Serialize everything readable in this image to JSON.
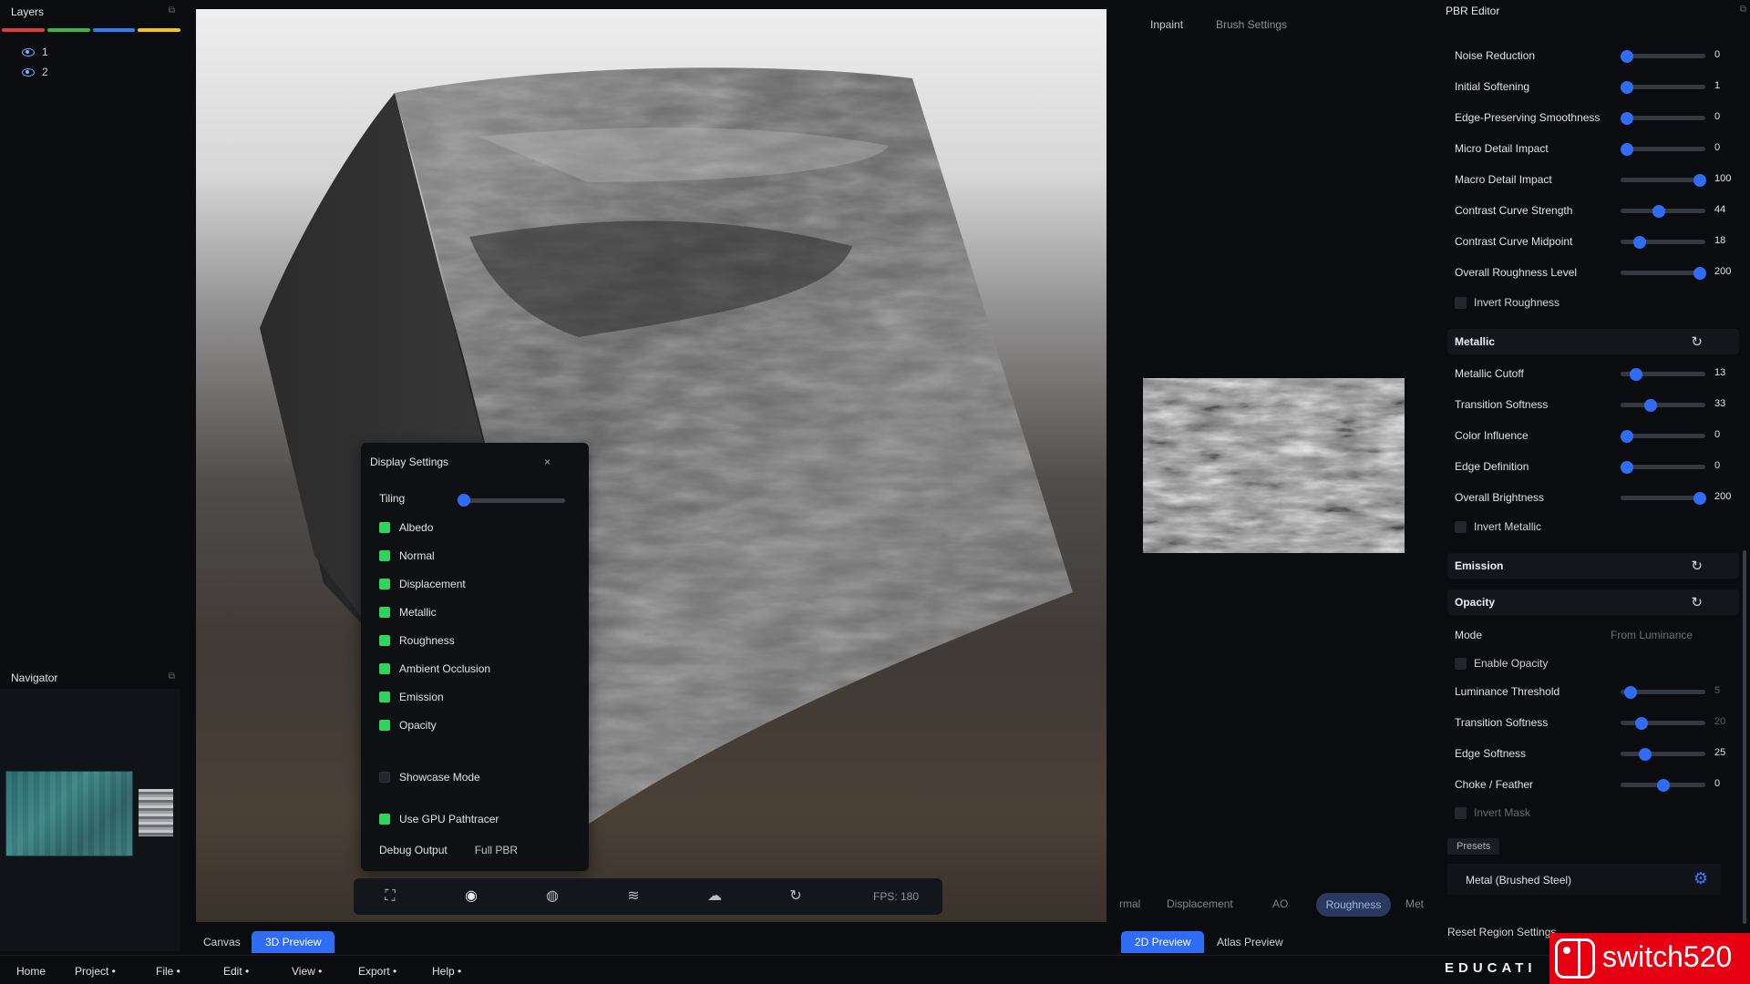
{
  "layers_panel": {
    "title": "Layers",
    "items": [
      {
        "label": "1"
      },
      {
        "label": "2"
      }
    ],
    "bar_colors": [
      "#e03a3a",
      "#39b54a",
      "#2f7df6",
      "#f2c417"
    ]
  },
  "navigator_panel": {
    "title": "Navigator"
  },
  "display_settings": {
    "title": "Display Settings",
    "close": "×",
    "tiling_label": "Tiling",
    "tiling_value": 0.0,
    "checks": [
      {
        "label": "Albedo",
        "checked": true
      },
      {
        "label": "Normal",
        "checked": true
      },
      {
        "label": "Displacement",
        "checked": true
      },
      {
        "label": "Metallic",
        "checked": true
      },
      {
        "label": "Roughness",
        "checked": true
      },
      {
        "label": "Ambient Occlusion",
        "checked": true
      },
      {
        "label": "Emission",
        "checked": true
      },
      {
        "label": "Opacity",
        "checked": true
      }
    ],
    "showcase": {
      "label": "Showcase Mode",
      "checked": false
    },
    "gpu": {
      "label": "Use GPU Pathtracer",
      "checked": true
    },
    "debug_label": "Debug Output",
    "debug_value": "Full PBR"
  },
  "view_toolbar": {
    "icons": [
      "screenshot-icon",
      "eye-icon",
      "globe-icon",
      "layers-icon",
      "cloud-sun-icon",
      "rotate-icon"
    ],
    "fps": "FPS: 180"
  },
  "left_tabs": [
    {
      "label": "Canvas",
      "active": false
    },
    {
      "label": "3D Preview",
      "active": true
    }
  ],
  "middle": {
    "tabs": [
      "Inpaint",
      "Brush Settings"
    ],
    "map_tabs": [
      "rmal",
      "Displacement",
      "AO",
      "Roughness",
      "Met"
    ],
    "active_map_tab": "Roughness",
    "bottom_tabs": [
      {
        "label": "2D Preview",
        "active": true
      },
      {
        "label": "Atlas Preview",
        "active": false
      }
    ]
  },
  "pbr_editor": {
    "title": "PBR Editor",
    "roughness_rows": [
      {
        "label": "Noise Reduction",
        "value": "0",
        "pos": 0.0
      },
      {
        "label": "Initial Softening",
        "value": "1",
        "pos": 0.0
      },
      {
        "label": "Edge-Preserving Smoothness",
        "value": "0",
        "pos": 0.0
      },
      {
        "label": "Micro Detail Impact",
        "value": "0",
        "pos": 0.0
      },
      {
        "label": "Macro Detail Impact",
        "value": "100",
        "pos": 1.0
      },
      {
        "label": "Contrast Curve Strength",
        "value": "44",
        "pos": 0.44
      },
      {
        "label": "Contrast Curve Midpoint",
        "value": "18",
        "pos": 0.18
      },
      {
        "label": "Overall Roughness Level",
        "value": "200",
        "pos": 1.0
      }
    ],
    "invert_roughness": "Invert Roughness",
    "metallic_header": "Metallic",
    "metallic_rows": [
      {
        "label": "Metallic Cutoff",
        "value": "13",
        "pos": 0.13
      },
      {
        "label": "Transition Softness",
        "value": "33",
        "pos": 0.33
      },
      {
        "label": "Color Influence",
        "value": "0",
        "pos": 0.0
      },
      {
        "label": "Edge Definition",
        "value": "0",
        "pos": 0.0
      },
      {
        "label": "Overall Brightness",
        "value": "200",
        "pos": 1.0
      }
    ],
    "invert_metallic": "Invert Metallic",
    "emission_header": "Emission",
    "opacity_header": "Opacity",
    "mode_label": "Mode",
    "mode_value": "From Luminance",
    "enable_opacity": "Enable Opacity",
    "opacity_rows": [
      {
        "label": "Luminance Threshold",
        "value": "5",
        "pos": 0.05,
        "muted": true
      },
      {
        "label": "Transition Softness",
        "value": "20",
        "pos": 0.2,
        "muted": true
      },
      {
        "label": "Edge Softness",
        "value": "25",
        "pos": 0.25,
        "muted": false
      },
      {
        "label": "Choke / Feather",
        "value": "0",
        "pos": 0.5,
        "muted": false
      }
    ],
    "invert_mask": "Invert Mask",
    "presets_tab": "Presets",
    "preset_value": "Metal (Brushed Steel)",
    "reset_region": "Reset Region Settings"
  },
  "menubar": {
    "items": [
      "Home",
      "Project •",
      "File •",
      "Edit •",
      "View •",
      "Export •",
      "Help •"
    ]
  },
  "brand": "EDUCATI",
  "watermark": "switch520"
}
